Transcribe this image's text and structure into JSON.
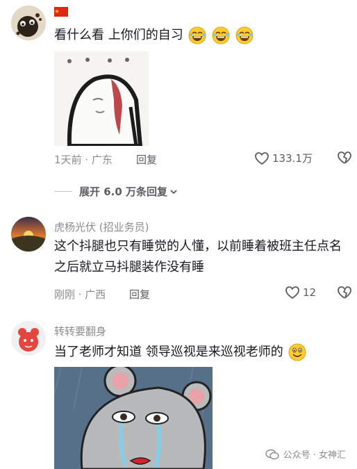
{
  "comments": [
    {
      "flag": "🇨🇳",
      "text": "看什么看  上你们的自习",
      "time_location": "1天前 · 广东",
      "reply_label": "回复",
      "likes": "133.1万"
    },
    {
      "name": "虎杨光伏",
      "tag": "(招业务员)",
      "text": "这个抖腿也只有睡觉的人懂，以前睡着被班主任点名之后就立马抖腿装作没有睡",
      "time_location": "刚刚 · 广西",
      "reply_label": "回复",
      "likes": "12"
    },
    {
      "name": "转转要翻身",
      "text": "当了老师才知道 领导巡视是来巡视老师的"
    }
  ],
  "expand_replies": "展开 6.0 万条回复",
  "watermark": "公众号 · 女神汇",
  "colors": {
    "text": "#161823",
    "muted": "#8a8b91",
    "divider": "#c9cacd"
  }
}
